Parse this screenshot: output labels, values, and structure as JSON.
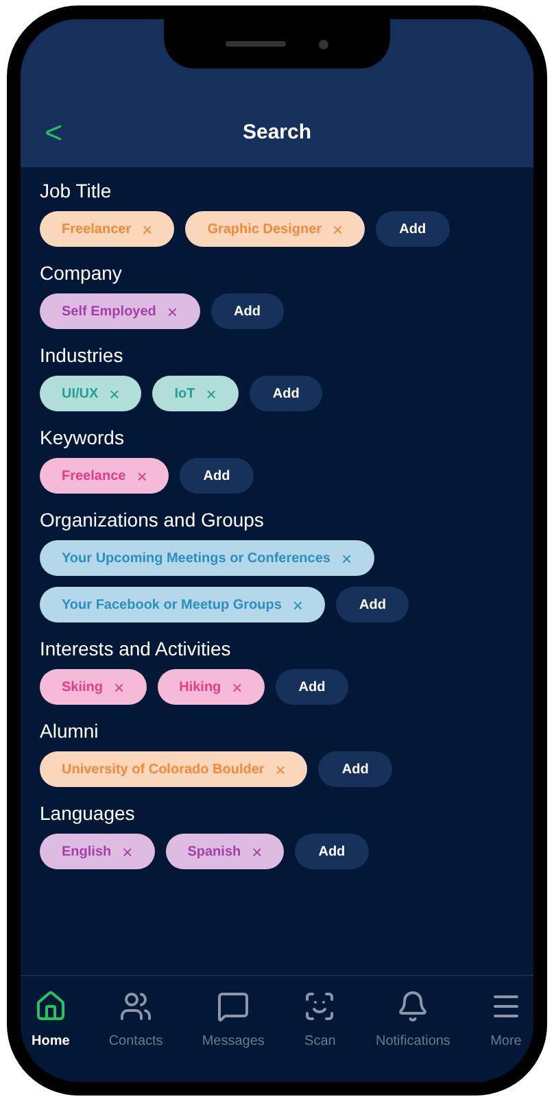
{
  "header": {
    "back": "<",
    "title": "Search"
  },
  "sections": [
    {
      "label": "Job Title",
      "chips": [
        {
          "text": "Freelancer",
          "remove": "×",
          "color": "#f08a3c"
        },
        {
          "text": "Graphic Designer",
          "remove": "×",
          "color": "#f08a3c"
        }
      ],
      "add": "Add"
    },
    {
      "label": "Company",
      "chips": [
        {
          "text": "Self Employed",
          "remove": "×",
          "color": "#a240a8"
        }
      ],
      "add": "Add"
    },
    {
      "label": "Industries",
      "chips": [
        {
          "text": "UI/UX",
          "remove": "×",
          "color": "#1fa090"
        },
        {
          "text": "IoT",
          "remove": "×",
          "color": "#1fa090"
        }
      ],
      "add": "Add"
    },
    {
      "label": "Keywords",
      "chips": [
        {
          "text": "Freelance",
          "remove": "×",
          "color": "#e23c8a"
        }
      ],
      "add": "Add"
    },
    {
      "label": "Organizations and Groups",
      "chips": [
        {
          "text": "Your Upcoming Meetings or Conferences",
          "remove": "×",
          "color": "#2a8fc0"
        },
        {
          "text": "Your Facebook or Meetup Groups",
          "remove": "×",
          "color": "#2a8fc0"
        }
      ],
      "add": "Add"
    },
    {
      "label": "Interests and Activities",
      "chips": [
        {
          "text": "Skiing",
          "remove": "×",
          "color": "#e23c8a"
        },
        {
          "text": "Hiking",
          "remove": "×",
          "color": "#e23c8a"
        }
      ],
      "add": "Add"
    },
    {
      "label": "Alumni",
      "chips": [
        {
          "text": "University of Colorado Boulder",
          "remove": "×",
          "color": "#f08a3c"
        }
      ],
      "add": "Add"
    },
    {
      "label": "Languages",
      "chips": [
        {
          "text": "English",
          "remove": "×",
          "color": "#a240a8"
        },
        {
          "text": "Spanish",
          "remove": "×",
          "color": "#a240a8"
        }
      ],
      "add": "Add"
    }
  ],
  "nav": [
    {
      "label": "Home",
      "kind": "home",
      "selected": true
    },
    {
      "label": "Contacts",
      "kind": "contacts",
      "selected": false
    },
    {
      "label": "Messages",
      "kind": "messages",
      "selected": false
    },
    {
      "label": "Scan",
      "kind": "scan",
      "selected": false
    },
    {
      "label": "Notifications",
      "kind": "notifications",
      "selected": false
    },
    {
      "label": "More",
      "kind": "more",
      "selected": false
    }
  ]
}
